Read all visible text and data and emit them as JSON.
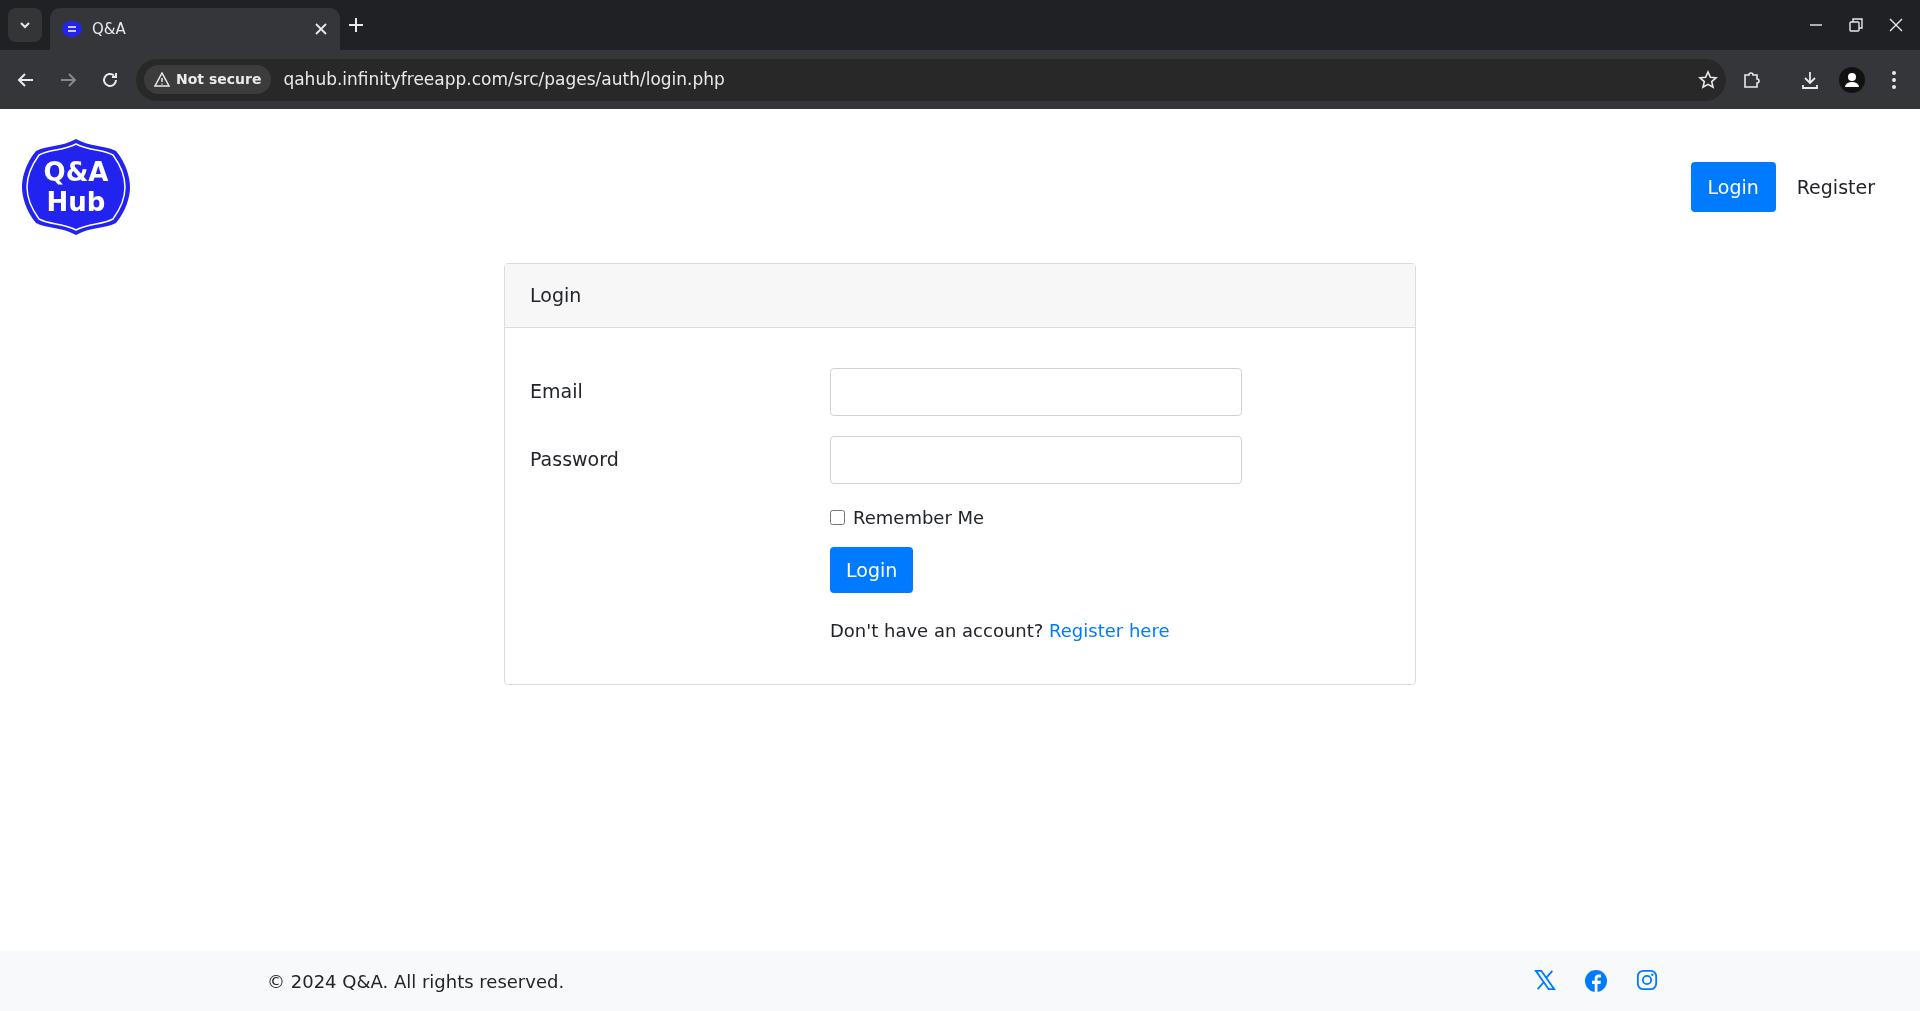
{
  "browser": {
    "tab": {
      "title": "Q&A"
    },
    "security": "Not secure",
    "url": "qahub.infinityfreeapp.com/src/pages/auth/login.php"
  },
  "logo": {
    "lines": [
      "Q&A",
      "Hub"
    ]
  },
  "nav": [
    {
      "label": "Login",
      "selected": true
    },
    {
      "label": "Register",
      "selected": false
    }
  ],
  "card": {
    "title": "Login",
    "fields": [
      {
        "label": "Email"
      },
      {
        "label": "Password"
      }
    ],
    "remember": {
      "label": "Remember Me",
      "checked": false
    },
    "submit": "Login",
    "prompt": "Don't have an account?",
    "link": "Register here"
  },
  "footer": {
    "copyright": "© 2024 Q&A. All rights reserved.",
    "social": [
      {
        "kind": "x"
      },
      {
        "kind": "facebook"
      },
      {
        "kind": "instagram"
      }
    ]
  }
}
